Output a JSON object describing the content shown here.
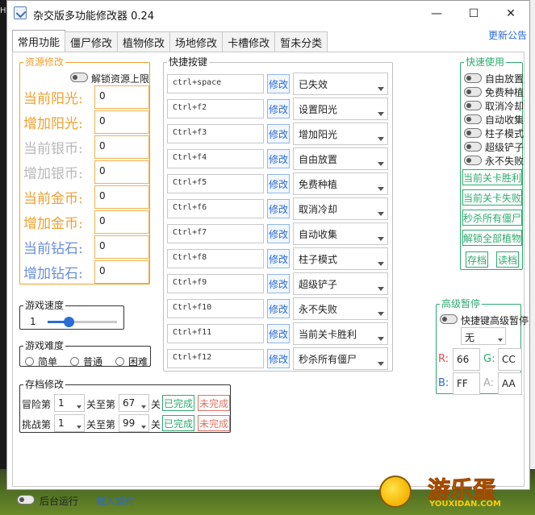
{
  "desktop": {
    "left_mark": "H"
  },
  "window": {
    "title": "杂交版多功能修改器  0.24",
    "controls": {
      "minimize": "—",
      "maximize": "☐",
      "close": "✕"
    }
  },
  "tabs": [
    {
      "label": "常用功能",
      "active": true
    },
    {
      "label": "僵尸修改"
    },
    {
      "label": "植物修改"
    },
    {
      "label": "场地修改"
    },
    {
      "label": "卡槽修改"
    },
    {
      "label": "暂未分类"
    }
  ],
  "announce_link": "更新公告",
  "resources": {
    "title": "资源修改",
    "unlock_label": "解锁资源上限",
    "rows": [
      {
        "label": "当前阳光:",
        "value": "0",
        "color": "#f0a030"
      },
      {
        "label": "增加阳光:",
        "value": "0",
        "color": "#f0a030"
      },
      {
        "label": "当前银币:",
        "value": "0",
        "color": "#b8b8b8"
      },
      {
        "label": "增加银币:",
        "value": "0",
        "color": "#b8b8b8"
      },
      {
        "label": "当前金币:",
        "value": "0",
        "color": "#f0a030"
      },
      {
        "label": "增加金币:",
        "value": "0",
        "color": "#f0a030"
      },
      {
        "label": "当前钻石:",
        "value": "0",
        "color": "#6a8fd8"
      },
      {
        "label": "增加钻石:",
        "value": "0",
        "color": "#6a8fd8"
      }
    ]
  },
  "shortcuts": {
    "title": "快捷按键",
    "modify_label": "修改",
    "rows": [
      {
        "key": "ctrl+space",
        "func": "已失效"
      },
      {
        "key": "Ctrl+f2",
        "func": "设置阳光"
      },
      {
        "key": "Ctrl+f3",
        "func": "增加阳光"
      },
      {
        "key": "Ctrl+f4",
        "func": "自由放置"
      },
      {
        "key": "Ctrl+f5",
        "func": "免费种植"
      },
      {
        "key": "Ctrl+f6",
        "func": "取消冷却"
      },
      {
        "key": "Ctrl+f7",
        "func": "自动收集"
      },
      {
        "key": "Ctrl+f8",
        "func": "柱子模式"
      },
      {
        "key": "Ctrl+f9",
        "func": "超级铲子"
      },
      {
        "key": "Ctrl+f10",
        "func": "永不失败"
      },
      {
        "key": "Ctrl+f11",
        "func": "当前关卡胜利"
      },
      {
        "key": "Ctrl+f12",
        "func": "秒杀所有僵尸"
      }
    ]
  },
  "quick_use": {
    "title": "快速使用",
    "toggles": [
      "自由放置",
      "免费种植",
      "取消冷却",
      "自动收集",
      "柱子模式",
      "超级铲子",
      "永不失败"
    ],
    "buttons": [
      "当前关卡胜利",
      "当前关卡失败",
      "秒杀所有僵尸",
      "解锁全部植物"
    ],
    "save_label": "存档",
    "load_label": "读档"
  },
  "speed": {
    "title": "游戏速度",
    "value": "1",
    "level": 0.3
  },
  "difficulty": {
    "title": "游戏难度",
    "options": [
      "简单",
      "普通",
      "困难"
    ]
  },
  "save_edit": {
    "title": "存档修改",
    "adventure": {
      "prefix": "冒险第",
      "world": "1",
      "mid": "关至第",
      "level": "67",
      "suffix": "关"
    },
    "challenge": {
      "prefix": "挑战第",
      "world": "1",
      "mid": "关至第",
      "level": "99",
      "suffix": "关"
    },
    "done_label": "已完成",
    "undone_label": "未完成"
  },
  "advanced_pause": {
    "title": "高级暂停",
    "toggle_label": "快捷键高级暂停",
    "key_value": "无",
    "r_label": "R:",
    "r_value": "66",
    "g_label": "G:",
    "g_value": "CC",
    "b_label": "B:",
    "b_value": "FF",
    "a_label": "A:",
    "a_value": "AA"
  },
  "bottom": {
    "bg_run_label": "后台运行",
    "plugin_link": "载入插件"
  },
  "logo": {
    "text": "游乐蛋",
    "sub": "YOUXIDAN.COM"
  }
}
